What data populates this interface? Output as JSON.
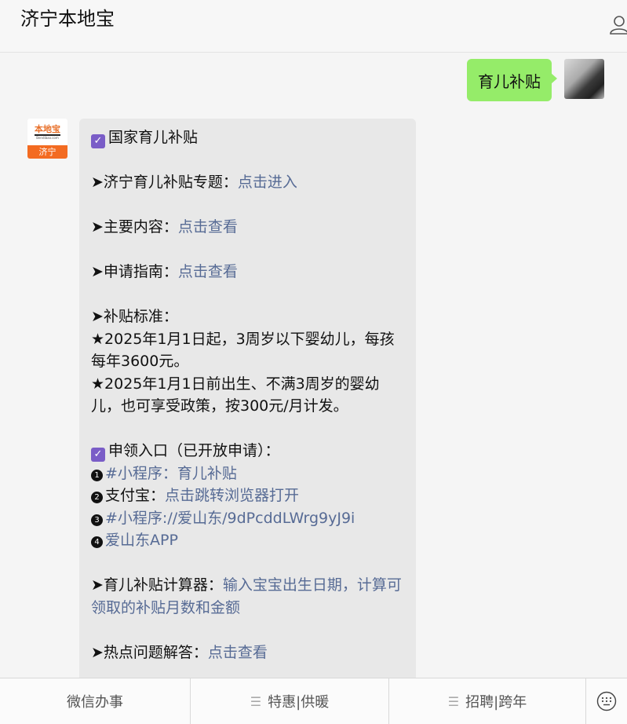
{
  "header": {
    "title": "济宁本地宝"
  },
  "user_message": {
    "text": "育儿补贴"
  },
  "bot_avatar": {
    "logo_text": "本地宝",
    "logo_url_text": "Bendibao.com",
    "city": "济宁"
  },
  "bot_message": {
    "heading": "国家育儿补贴",
    "topic": {
      "label": "➤济宁育儿补贴专题：",
      "link": "点击进入"
    },
    "main_content": {
      "label": "➤主要内容：",
      "link": "点击查看"
    },
    "guide": {
      "label": "➤申请指南：",
      "link": "点击查看"
    },
    "standard_label": "➤补贴标准：",
    "standard_1": "★2025年1月1日起，3周岁以下婴幼儿，每孩每年3600元。",
    "standard_2": "★2025年1月1日前出生、不满3周岁的婴幼儿，也可享受政策，按300元/月计发。",
    "apply_heading": "申领入口（已开放申请）：",
    "entry_1": {
      "num": "1",
      "link": "#小程序：育儿补贴"
    },
    "entry_2": {
      "num": "2",
      "label": "支付宝：",
      "link": "点击跳转浏览器打开"
    },
    "entry_3": {
      "num": "3",
      "link": "#小程序://爱山东/9dPcddLWrg9yJ9i"
    },
    "entry_4": {
      "num": "4",
      "link": "爱山东APP"
    },
    "calculator": {
      "label": "➤育儿补贴计算器：",
      "link": "输入宝宝出生日期，计算可领取的补贴月数和金额"
    },
    "faq": {
      "label": "➤热点问题解答：",
      "link": "点击查看"
    }
  },
  "bottom_menu": {
    "item_1": "微信办事",
    "item_2": "特惠|供暖",
    "item_3": "招聘|跨年"
  },
  "colors": {
    "link": "#576b95",
    "user_bubble": "#95ec69",
    "check": "#7a5dc7",
    "logo_orange": "#f36b21"
  }
}
